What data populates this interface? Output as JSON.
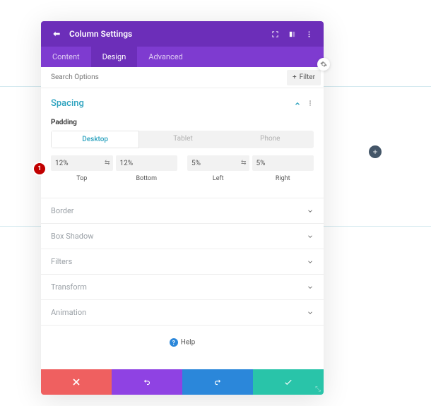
{
  "header": {
    "title": "Column Settings"
  },
  "tabs": [
    "Content",
    "Design",
    "Advanced"
  ],
  "active_tab": 1,
  "search": {
    "placeholder": "Search Options",
    "filter_label": "Filter"
  },
  "panel": {
    "title": "Spacing",
    "sublabel": "Padding",
    "device_tabs": [
      "Desktop",
      "Tablet",
      "Phone"
    ],
    "active_device": 0,
    "padding": {
      "top": {
        "value": "12%",
        "label": "Top"
      },
      "bottom": {
        "value": "12%",
        "label": "Bottom"
      },
      "left": {
        "value": "5%",
        "label": "Left"
      },
      "right": {
        "value": "5%",
        "label": "Right"
      }
    }
  },
  "accordions": [
    "Border",
    "Box Shadow",
    "Filters",
    "Transform",
    "Animation"
  ],
  "help_label": "Help",
  "annotation": "1",
  "colors": {
    "header": "#6c2eb9",
    "tabs": "#7e3bd0",
    "accent": "#2ea3bf",
    "cancel": "#ef6060",
    "undo": "#8f42e3",
    "redo": "#2b87da",
    "save": "#29c4a9"
  }
}
